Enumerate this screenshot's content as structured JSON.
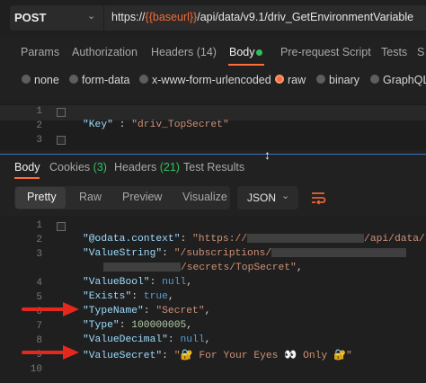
{
  "request": {
    "method": "POST",
    "url_prefix": "https://",
    "url_var": "{{baseurl}}",
    "url_suffix": "/api/data/v9.1/driv_GetEnvironmentVariable"
  },
  "request_tabs": [
    {
      "label": "Params"
    },
    {
      "label": "Authorization"
    },
    {
      "label": "Headers (14)"
    },
    {
      "label": "Body"
    },
    {
      "label": "Pre-request Script"
    },
    {
      "label": "Tests"
    },
    {
      "label": "S"
    }
  ],
  "body_types": [
    "none",
    "form-data",
    "x-www-form-urlencoded",
    "raw",
    "binary",
    "GraphQL"
  ],
  "body_type_selected": "raw",
  "request_body": {
    "line_numbers": [
      "1",
      "2",
      "3"
    ],
    "key": "\"Key\"",
    "colon": " : ",
    "value": "\"driv_TopSecret\""
  },
  "response_tabs": {
    "body": "Body",
    "cookies": "Cookies",
    "cookies_count": "(3)",
    "headers": "Headers",
    "headers_count": "(21)",
    "test_results": "Test Results"
  },
  "format_options": [
    "Pretty",
    "Raw",
    "Preview",
    "Visualize"
  ],
  "format_selected": "Pretty",
  "language_select": "JSON",
  "response_body": {
    "line_numbers": [
      "1",
      "2",
      "3",
      "",
      "4",
      "5",
      "6",
      "7",
      "8",
      "9",
      "10"
    ],
    "odata_key": "\"@odata.context\"",
    "odata_val_start": "\"https://",
    "odata_val_end": "/api/data/",
    "valuestring_key": "\"ValueString\"",
    "valuestring_val_start": "\"/subscriptions/",
    "valuestring_cont_end": "/secrets/TopSecret\"",
    "valuebool_key": "\"ValueBool\"",
    "valuebool_val": "null",
    "exists_key": "\"Exists\"",
    "exists_val": "true",
    "typename_key": "\"TypeName\"",
    "typename_val": "\"Secret\"",
    "type_key": "\"Type\"",
    "type_val": "100000005",
    "valuedecimal_key": "\"ValueDecimal\"",
    "valuedecimal_val": "null",
    "valuesecret_key": "\"ValueSecret\"",
    "valuesecret_val": "\"🔐 For Your Eyes 👀 Only 🔐\""
  },
  "colors": {
    "accent": "#ff6c37",
    "count_green": "#33c05b",
    "arrow_red": "#e5281e",
    "variable_orange": "#f26b3a"
  }
}
